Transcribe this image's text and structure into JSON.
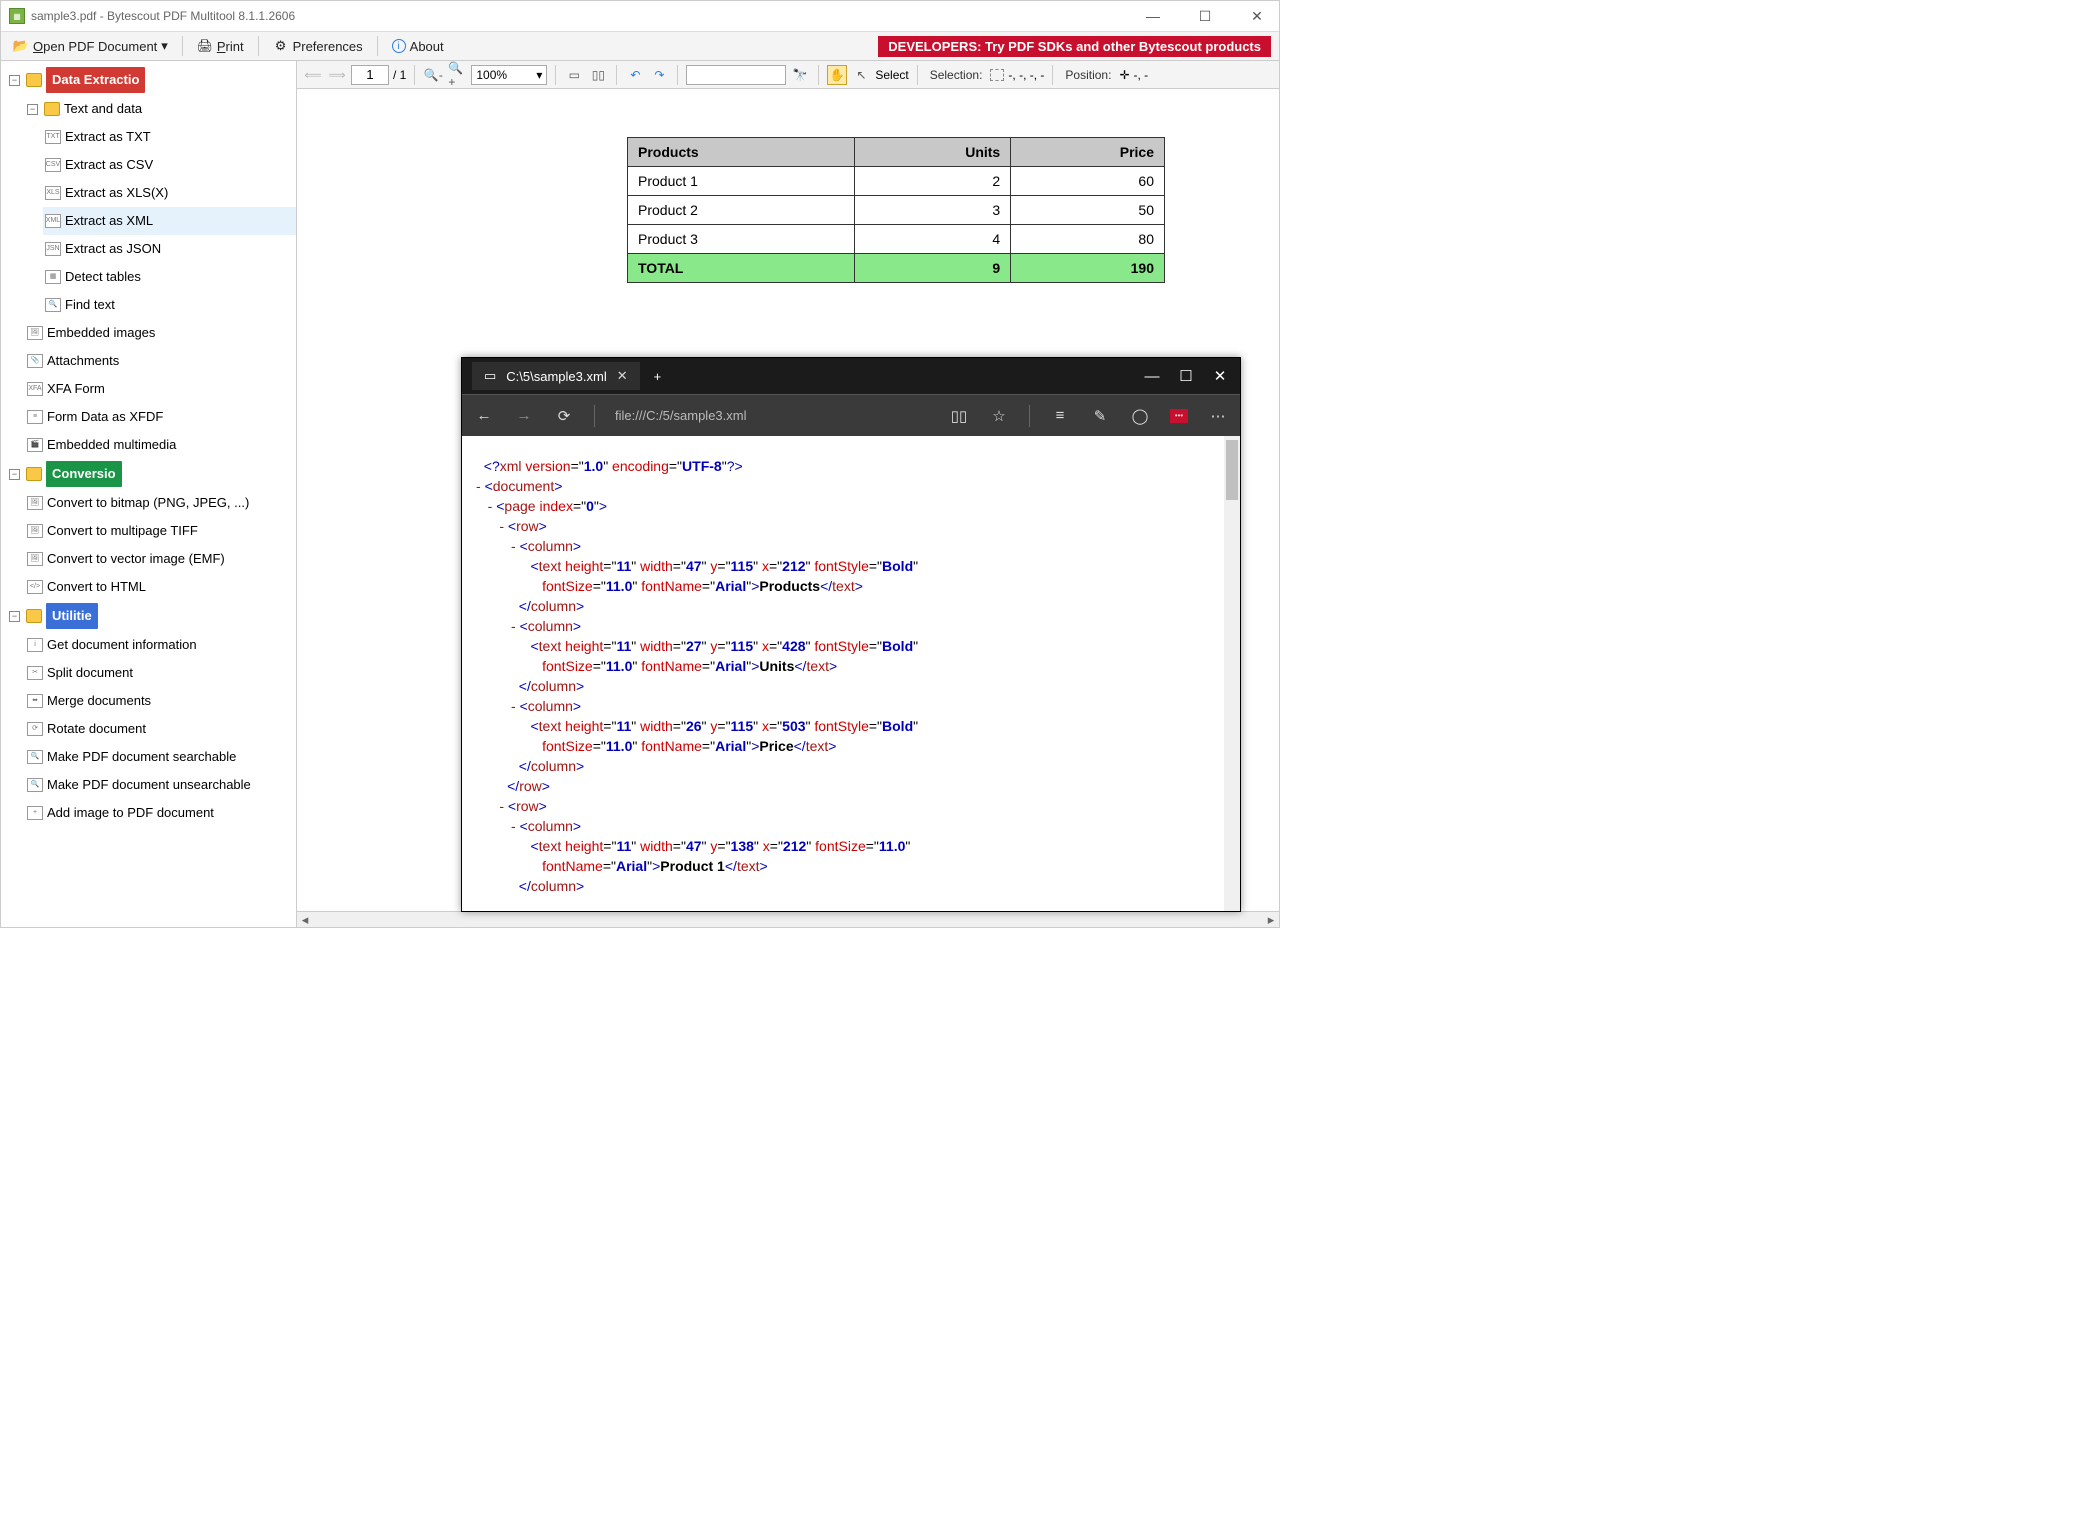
{
  "app": {
    "title": "sample3.pdf - Bytescout PDF Multitool 8.1.1.2606"
  },
  "menu": {
    "open": "Open PDF Document",
    "print": "Print",
    "prefs": "Preferences",
    "about": "About",
    "promo": "DEVELOPERS: Try PDF SDKs and other Bytescout products"
  },
  "toolbar": {
    "page": "1",
    "pages": "/ 1",
    "zoom": "100%",
    "select": "Select",
    "selection": "Selection:",
    "selvals": "-, -, -, -",
    "position": "Position:",
    "posvals": "-, -"
  },
  "tree": {
    "data_extraction": "Data Extractio",
    "text_and_data": "Text and data",
    "extract_txt": "Extract as TXT",
    "extract_csv": "Extract as CSV",
    "extract_xlsx": "Extract as XLS(X)",
    "extract_xml": "Extract as XML",
    "extract_json": "Extract as JSON",
    "detect_tables": "Detect tables",
    "find_text": "Find text",
    "embedded_images": "Embedded images",
    "attachments": "Attachments",
    "xfa_form": "XFA Form",
    "form_xfdf": "Form Data as XFDF",
    "embedded_mm": "Embedded multimedia",
    "conversion": "Conversio",
    "conv_bitmap": "Convert to bitmap (PNG, JPEG, ...)",
    "conv_tiff": "Convert to multipage TIFF",
    "conv_vector": "Convert to vector image (EMF)",
    "conv_html": "Convert to HTML",
    "utilities": "Utilitie",
    "get_info": "Get document information",
    "split": "Split document",
    "merge": "Merge documents",
    "rotate": "Rotate document",
    "searchable": "Make PDF document searchable",
    "unsearchable": "Make PDF document unsearchable",
    "add_image": "Add image to PDF document"
  },
  "table": {
    "h1": "Products",
    "h2": "Units",
    "h3": "Price",
    "rows": [
      {
        "p": "Product 1",
        "u": "2",
        "r": "60"
      },
      {
        "p": "Product 2",
        "u": "3",
        "r": "50"
      },
      {
        "p": "Product 3",
        "u": "4",
        "r": "80"
      }
    ],
    "total": {
      "p": "TOTAL",
      "u": "9",
      "r": "190"
    }
  },
  "browser": {
    "tab": "C:\\5\\sample3.xml",
    "url": "file:///C:/5/sample3.xml"
  },
  "chart_data": {
    "type": "table",
    "title": "Products table",
    "columns": [
      "Products",
      "Units",
      "Price"
    ],
    "rows": [
      [
        "Product 1",
        2,
        60
      ],
      [
        "Product 2",
        3,
        50
      ],
      [
        "Product 3",
        4,
        80
      ]
    ],
    "total": [
      "TOTAL",
      9,
      190
    ]
  }
}
